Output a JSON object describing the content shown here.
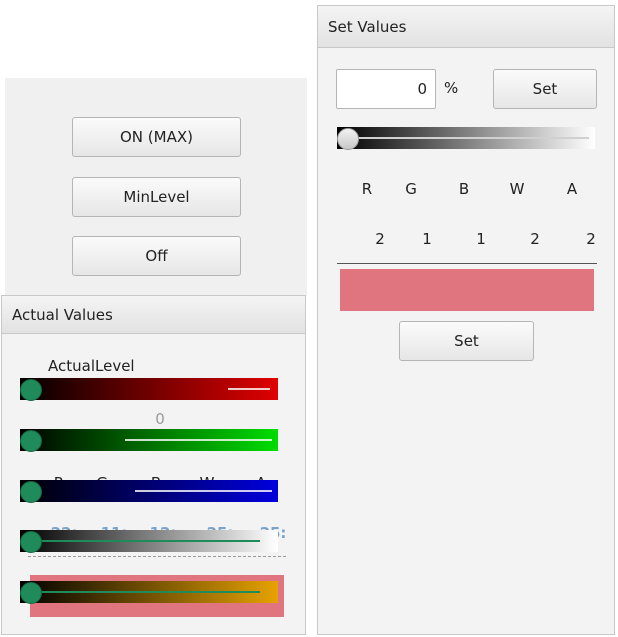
{
  "controls": {
    "on_max_label": "ON (MAX)",
    "min_level_label": "MinLevel",
    "off_label": "Off"
  },
  "actual": {
    "title": "Actual Values",
    "level_label": "ActualLevel",
    "level_value": "0",
    "channel_labels": [
      "R",
      "G",
      "B",
      "W",
      "A"
    ],
    "channel_values": [
      "22:",
      "11:",
      "12:",
      "25:",
      "25:"
    ],
    "color_swatch": "#e07580"
  },
  "set_values": {
    "title": "Set Values",
    "percent_value": "0",
    "percent_unit": "%",
    "set_label": "Set",
    "master_slider_level": 0,
    "channel_labels": [
      "R",
      "G",
      "B",
      "W",
      "A"
    ],
    "channel_values": [
      "2",
      "1",
      "1",
      "2",
      "2"
    ],
    "color_swatch": "#e07580",
    "set_color_label": "Set",
    "channel_sliders": [
      {
        "channel": "red",
        "color": "#e00000",
        "level": 0
      },
      {
        "channel": "green",
        "color": "#00dd00",
        "level": 0
      },
      {
        "channel": "blue",
        "color": "#0000dd",
        "level": 0
      },
      {
        "channel": "white",
        "color": "#ffffff",
        "level": 0
      },
      {
        "channel": "amber",
        "color": "#e6a200",
        "level": 0
      }
    ]
  }
}
